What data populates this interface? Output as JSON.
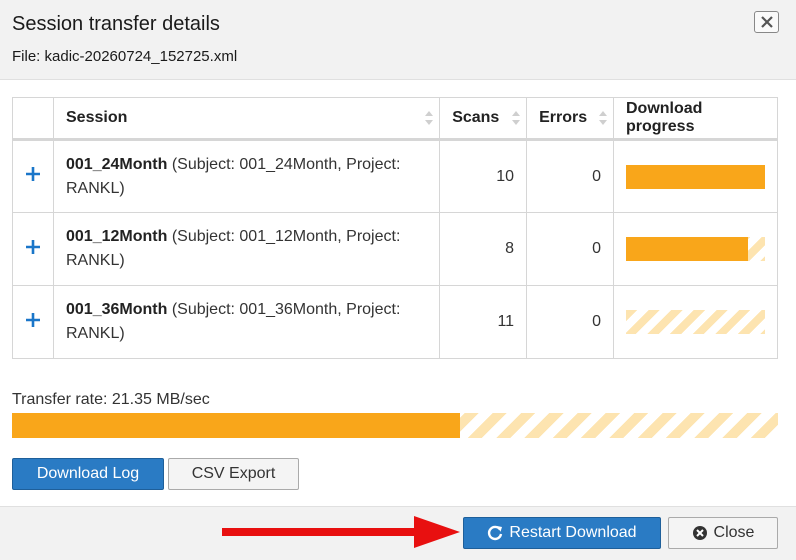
{
  "dialog": {
    "title": "Session transfer details",
    "file_label": "File: kadic-20260724_152725.xml"
  },
  "table": {
    "headers": {
      "session": "Session",
      "scans": "Scans",
      "errors": "Errors",
      "progress": "Download progress"
    },
    "rows": [
      {
        "name": "001_24Month",
        "details": " (Subject: 001_24Month, Project: RANKL)",
        "scans": "10",
        "errors": "0",
        "progress": 1.0
      },
      {
        "name": "001_12Month",
        "details": " (Subject: 001_12Month, Project: RANKL)",
        "scans": "8",
        "errors": "0",
        "progress": 0.88
      },
      {
        "name": "001_36Month",
        "details": " (Subject: 001_36Month, Project: RANKL)",
        "scans": "11",
        "errors": "0",
        "progress": 0.0
      }
    ]
  },
  "transfer": {
    "rate_label": "Transfer rate: 21.35 MB/sec",
    "overall_progress": 0.585
  },
  "buttons": {
    "download_log": "Download Log",
    "csv_export": "CSV Export",
    "restart_download": "Restart Download",
    "close": "Close"
  },
  "colors": {
    "progress_fill": "#f9a61a",
    "primary": "#2a7bc4",
    "arrow": "#e81010",
    "plus": "#1a76c9"
  },
  "icons": {
    "close_x": "close-icon",
    "expand": "plus-icon",
    "sort": "sort-icon",
    "restart": "refresh-icon",
    "close_button": "close-circle-icon"
  }
}
